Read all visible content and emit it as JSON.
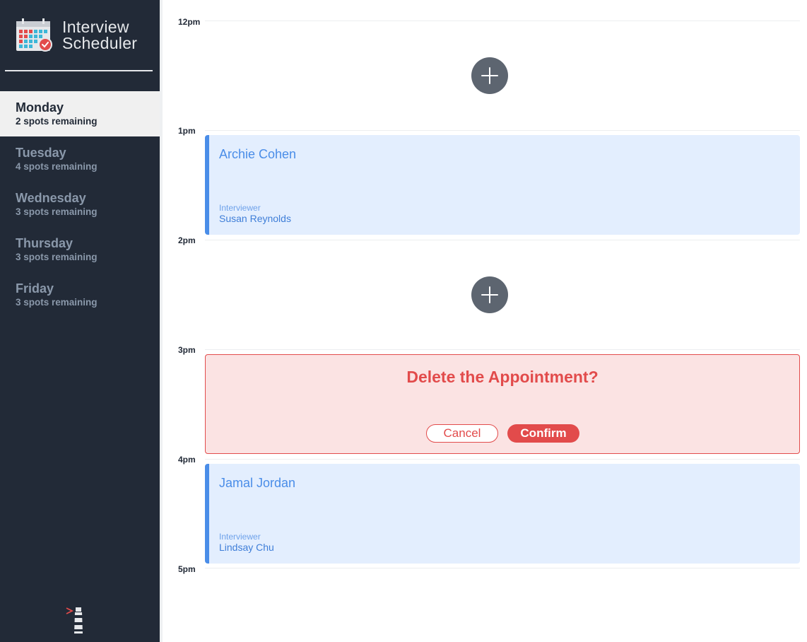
{
  "app": {
    "title_line1": "Interview",
    "title_line2": "Scheduler"
  },
  "days": [
    {
      "name": "Monday",
      "spots": "2 spots remaining",
      "selected": true
    },
    {
      "name": "Tuesday",
      "spots": "4 spots remaining",
      "selected": false
    },
    {
      "name": "Wednesday",
      "spots": "3 spots remaining",
      "selected": false
    },
    {
      "name": "Thursday",
      "spots": "3 spots remaining",
      "selected": false
    },
    {
      "name": "Friday",
      "spots": "3 spots remaining",
      "selected": false
    }
  ],
  "times": [
    "12pm",
    "1pm",
    "2pm",
    "3pm",
    "4pm",
    "5pm"
  ],
  "appointments": [
    {
      "student": "Archie Cohen",
      "interviewer_label": "Interviewer",
      "interviewer": "Susan Reynolds"
    },
    {
      "student": "Jamal Jordan",
      "interviewer_label": "Interviewer",
      "interviewer": "Lindsay Chu"
    }
  ],
  "confirm": {
    "message": "Delete the Appointment?",
    "cancel_label": "Cancel",
    "confirm_label": "Confirm"
  },
  "icons": {
    "logo": "calendar-check-icon",
    "add": "plus-icon",
    "footer": "lighthouse-icon"
  },
  "colors": {
    "sidebar": "#222a37",
    "accent_blue": "#4a8de8",
    "danger": "#e24b4b",
    "add_button": "#5d6570"
  }
}
